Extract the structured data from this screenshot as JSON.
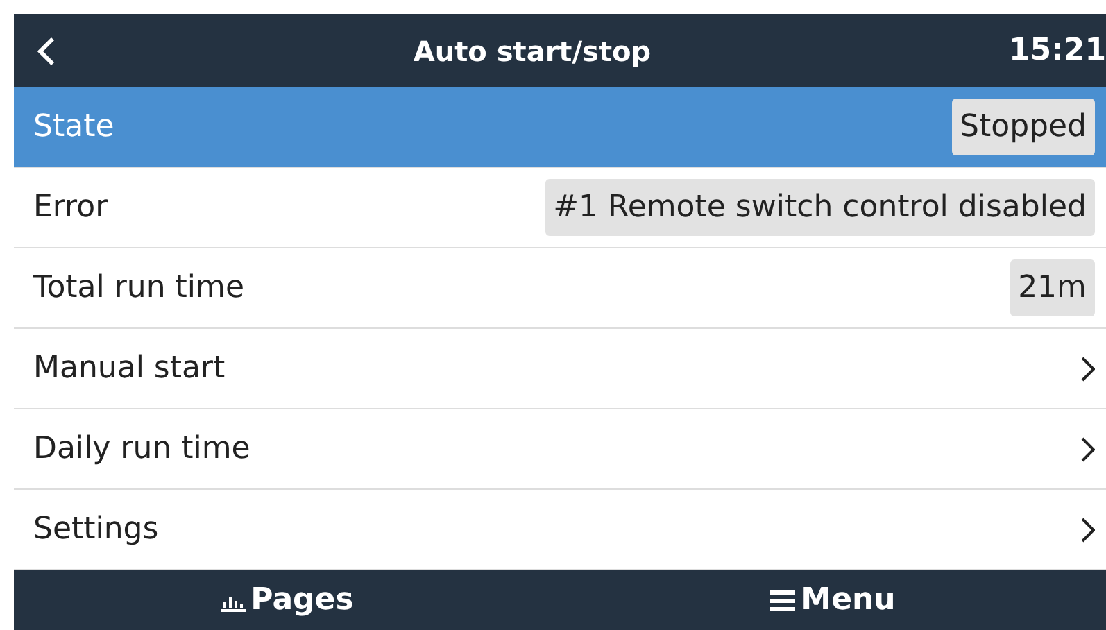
{
  "header": {
    "title": "Auto start/stop",
    "time": "15:21"
  },
  "rows": [
    {
      "label": "State",
      "kind": "value",
      "value": "Stopped",
      "selected": true
    },
    {
      "label": "Error",
      "kind": "value",
      "value": "#1 Remote switch control disabled",
      "selected": false
    },
    {
      "label": "Total run time",
      "kind": "value",
      "value": "21m",
      "selected": false
    },
    {
      "label": "Manual start",
      "kind": "submenu",
      "selected": false
    },
    {
      "label": "Daily run time",
      "kind": "submenu",
      "selected": false
    },
    {
      "label": "Settings",
      "kind": "submenu",
      "selected": false
    }
  ],
  "footer": {
    "pages": "Pages",
    "menu": "Menu"
  }
}
